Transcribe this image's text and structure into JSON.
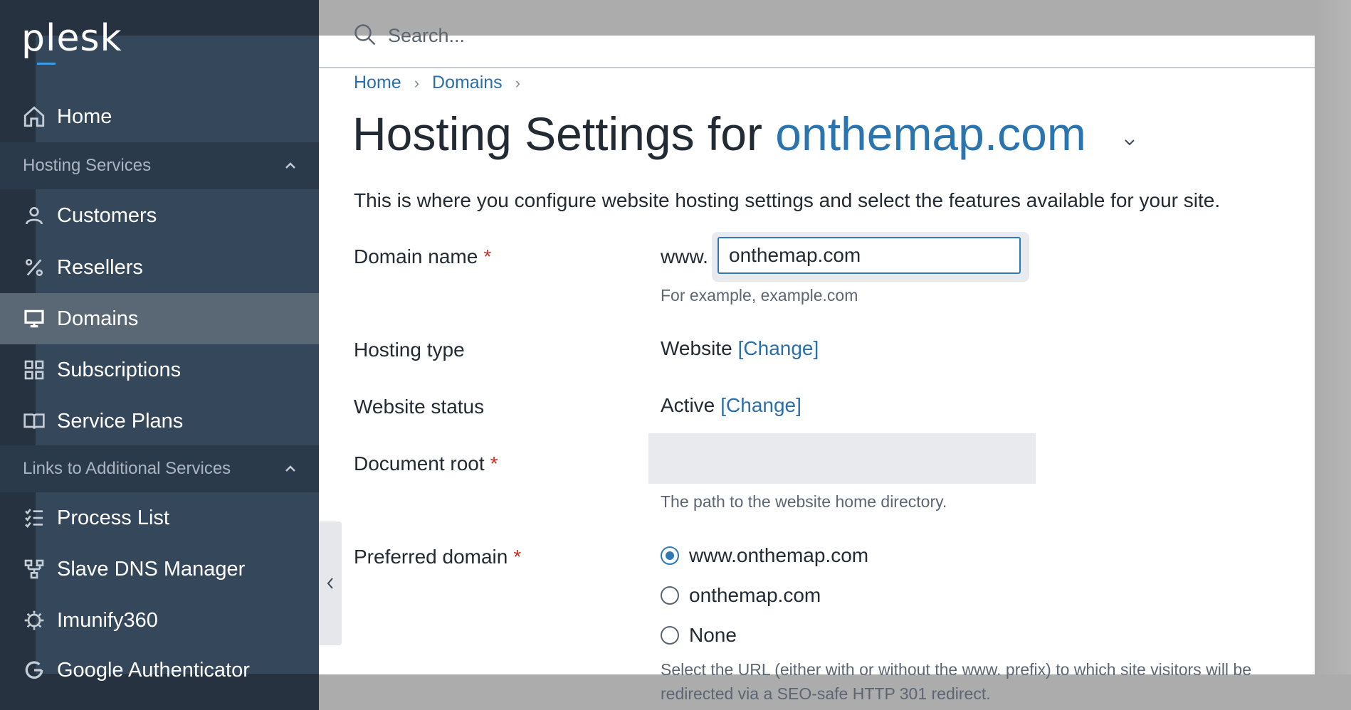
{
  "sidebar": {
    "logo": "plesk",
    "items": {
      "home": "Home",
      "section_hosting": "Hosting Services",
      "customers": "Customers",
      "resellers": "Resellers",
      "domains": "Domains",
      "subscriptions": "Subscriptions",
      "service_plans": "Service Plans",
      "section_links": "Links to Additional Services",
      "process_list": "Process List",
      "slave_dns": "Slave DNS Manager",
      "imunify": "Imunify360",
      "google_auth": "Google Authenticator"
    },
    "active_item": "Domains"
  },
  "search": {
    "placeholder": "Search..."
  },
  "breadcrumb": {
    "home": "Home",
    "domains": "Domains"
  },
  "page": {
    "title_prefix": "Hosting Settings for ",
    "title_domain": "onthemap.com",
    "description": "This is where you configure website hosting settings and select the features available for your site."
  },
  "form": {
    "domain_name": {
      "label": "Domain name",
      "prefix": "www.",
      "value": "onthemap.com",
      "hint": "For example, example.com"
    },
    "hosting_type": {
      "label": "Hosting type",
      "value": "Website",
      "change": "[Change]"
    },
    "website_status": {
      "label": "Website status",
      "value": "Active",
      "change": "[Change]"
    },
    "document_root": {
      "label": "Document root",
      "value": "",
      "hint": "The path to the website home directory."
    },
    "preferred_domain": {
      "label": "Preferred domain",
      "options": [
        "www.onthemap.com",
        "onthemap.com",
        "None"
      ],
      "selected": "www.onthemap.com",
      "hint": "Select the URL (either with or without the www. prefix) to which site visitors will be redirected via a SEO-safe HTTP 301 redirect."
    },
    "required_mark": "*"
  },
  "colors": {
    "sidebar": "#35475b",
    "sidebar_dark": "#26323f",
    "active_item": "#5a6775",
    "link": "#2a6fad",
    "required": "#d02c2c"
  }
}
